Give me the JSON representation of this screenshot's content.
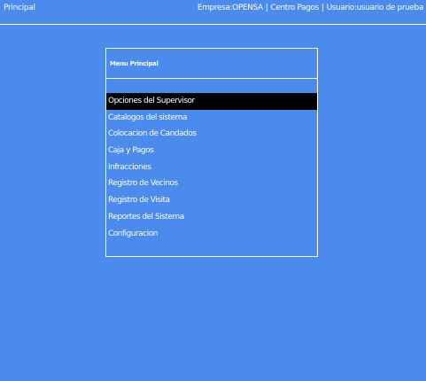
{
  "header": {
    "title": "Principal",
    "empresa": "Empresa:OPENSA",
    "centro": "Centro Pagos",
    "usuario": "Usuario:usuario de prueba",
    "separator": "|"
  },
  "menu": {
    "title": "Menu Principal",
    "items": [
      {
        "label": "Opciones del Supervisor",
        "selected": true
      },
      {
        "label": "Catalogos del sistema"
      },
      {
        "label": "Colocacion de Candados"
      },
      {
        "label": "Caja y Pagos"
      },
      {
        "label": "Infracciones"
      },
      {
        "label": "Registro de Vecinos"
      },
      {
        "label": "Registro de Visita"
      },
      {
        "label": "Reportes del Sistema"
      },
      {
        "label": "Configuracion"
      }
    ]
  }
}
